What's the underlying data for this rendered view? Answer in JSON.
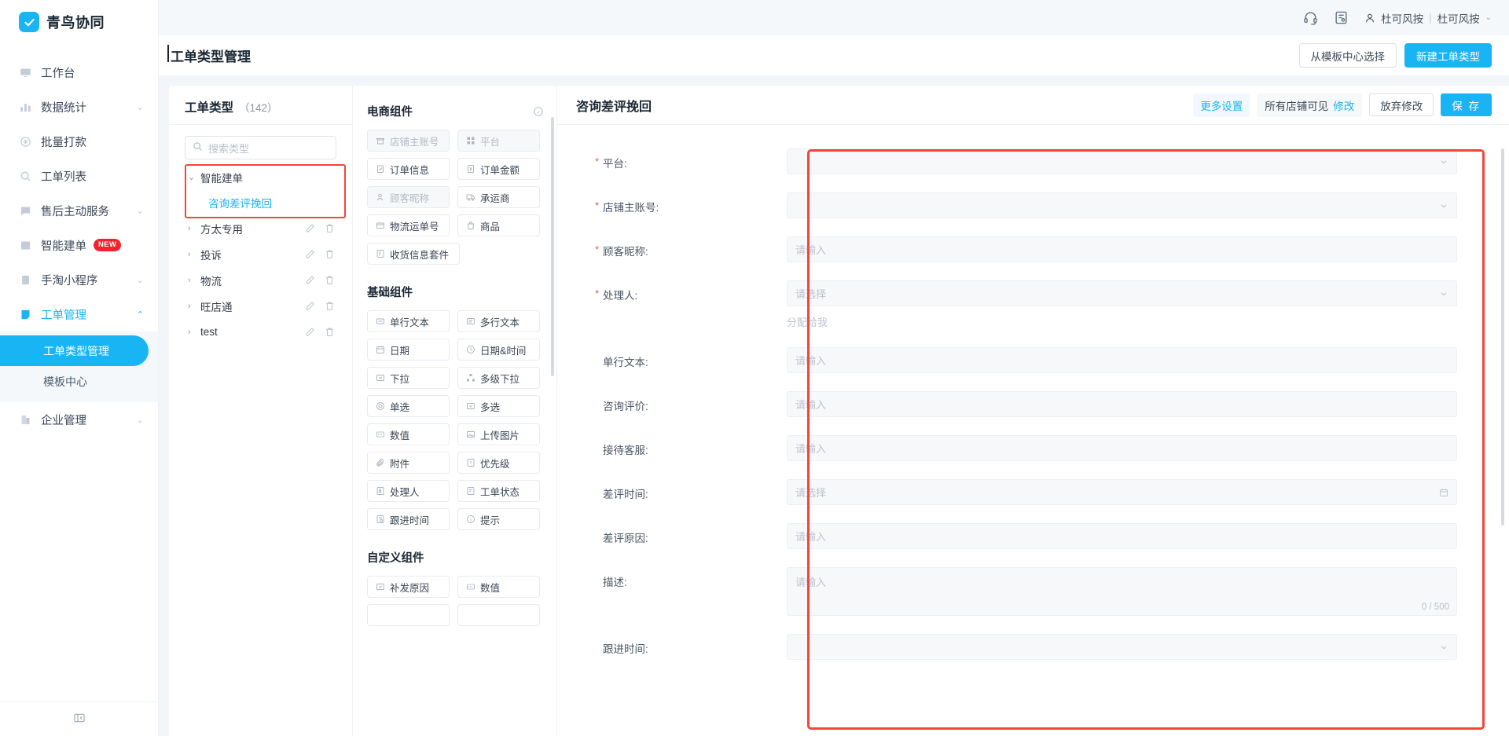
{
  "brand": {
    "name": "青鸟协同",
    "mark_icon": "check-badge-icon"
  },
  "sidebar": {
    "items": [
      {
        "label": "工作台",
        "icon": "desktop-icon",
        "caret": "",
        "active": false
      },
      {
        "label": "数据统计",
        "icon": "bar-chart-icon",
        "caret": "⌄",
        "active": false
      },
      {
        "label": "批量打款",
        "icon": "coin-icon",
        "caret": "",
        "active": false
      },
      {
        "label": "工单列表",
        "icon": "search-icon",
        "caret": "",
        "active": false
      },
      {
        "label": "售后主动服务",
        "icon": "message-check-icon",
        "caret": "⌄",
        "active": false
      },
      {
        "label": "智能建单",
        "icon": "list-icon",
        "caret": "",
        "badge": "NEW",
        "active": false
      },
      {
        "label": "手淘小程序",
        "icon": "clipboard-icon",
        "caret": "⌄",
        "active": false
      },
      {
        "label": "工单管理",
        "icon": "ticket-icon",
        "caret": "⌃",
        "active": true
      },
      {
        "label": "企业管理",
        "icon": "building-icon",
        "caret": "⌄",
        "active": false
      }
    ],
    "sub_items": [
      {
        "label": "工单类型管理",
        "selected": true
      },
      {
        "label": "模板中心",
        "selected": false
      }
    ],
    "collapse_icon": "collapse-sidebar-icon"
  },
  "topbar": {
    "headset_icon": "headset-icon",
    "doc_icon": "document-icon",
    "user_icon": "user-icon",
    "user_name": "杜可风按",
    "separator": "|",
    "account_name": "杜可风按",
    "caret": "⌄"
  },
  "page": {
    "title": "工单类型管理",
    "actions": [
      {
        "label": "从模板中心选择",
        "primary": false
      },
      {
        "label": "新建工单类型",
        "primary": true
      }
    ]
  },
  "types_panel": {
    "title": "工单类型",
    "count": "（142）",
    "search_placeholder": "搜索类型",
    "search_icon": "search-icon",
    "tree": [
      {
        "label": "智能建单",
        "arrow": "⌄",
        "expanded": true,
        "highlighted": true,
        "has_actions": false,
        "children": [
          {
            "label": "咨询差评挽回",
            "selected": true
          }
        ]
      },
      {
        "label": "方太专用",
        "arrow": "›",
        "expanded": false,
        "has_actions": true,
        "children": []
      },
      {
        "label": "投诉",
        "arrow": "›",
        "expanded": false,
        "has_actions": true,
        "children": []
      },
      {
        "label": "物流",
        "arrow": "›",
        "expanded": false,
        "has_actions": true,
        "children": []
      },
      {
        "label": "旺店通",
        "arrow": "›",
        "expanded": false,
        "has_actions": true,
        "children": []
      },
      {
        "label": "test",
        "arrow": "›",
        "expanded": false,
        "has_actions": true,
        "children": []
      }
    ],
    "edit_icon": "pencil-icon",
    "delete_icon": "trash-icon"
  },
  "palette": {
    "info_icon": "info-circle-icon",
    "sections": [
      {
        "title": "电商组件",
        "items": [
          {
            "label": "店铺主账号",
            "icon": "shop-icon",
            "disabled": true
          },
          {
            "label": "平台",
            "icon": "grid-icon",
            "disabled": true
          },
          {
            "label": "订单信息",
            "icon": "clipboard-check-icon",
            "disabled": false
          },
          {
            "label": "订单金额",
            "icon": "money-icon",
            "disabled": false
          },
          {
            "label": "顾客昵称",
            "icon": "user-icon",
            "disabled": true
          },
          {
            "label": "承运商",
            "icon": "truck-icon",
            "disabled": false
          },
          {
            "label": "物流运单号",
            "icon": "package-icon",
            "disabled": false
          },
          {
            "label": "商品",
            "icon": "bag-icon",
            "disabled": false
          },
          {
            "label": "收货信息套件",
            "icon": "address-icon",
            "disabled": false
          }
        ]
      },
      {
        "title": "基础组件",
        "items": [
          {
            "label": "单行文本",
            "icon": "single-line-icon",
            "disabled": false
          },
          {
            "label": "多行文本",
            "icon": "multi-line-icon",
            "disabled": false
          },
          {
            "label": "日期",
            "icon": "calendar-icon",
            "disabled": false
          },
          {
            "label": "日期&时间",
            "icon": "clock-icon",
            "disabled": false
          },
          {
            "label": "下拉",
            "icon": "dropdown-icon",
            "disabled": false
          },
          {
            "label": "多级下拉",
            "icon": "cascader-icon",
            "disabled": false
          },
          {
            "label": "单选",
            "icon": "radio-icon",
            "disabled": false
          },
          {
            "label": "多选",
            "icon": "checkbox-icon",
            "disabled": false
          },
          {
            "label": "数值",
            "icon": "number-icon",
            "disabled": false
          },
          {
            "label": "上传图片",
            "icon": "image-icon",
            "disabled": false
          },
          {
            "label": "附件",
            "icon": "paperclip-icon",
            "disabled": false
          },
          {
            "label": "优先级",
            "icon": "priority-icon",
            "disabled": false
          },
          {
            "label": "处理人",
            "icon": "assignee-icon",
            "disabled": false
          },
          {
            "label": "工单状态",
            "icon": "status-icon",
            "disabled": false
          },
          {
            "label": "跟进时间",
            "icon": "followup-icon",
            "disabled": false
          },
          {
            "label": "提示",
            "icon": "info-circle-icon",
            "disabled": false
          }
        ]
      },
      {
        "title": "自定义组件",
        "items": [
          {
            "label": "补发原因",
            "icon": "dropdown-icon",
            "disabled": false
          },
          {
            "label": "数值",
            "icon": "number-icon",
            "disabled": false
          }
        ]
      }
    ]
  },
  "form": {
    "name": "咨询差评挽回",
    "more_settings": "更多设置",
    "visibility": "所有店铺可见",
    "visibility_edit": "修改",
    "discard": "放弃修改",
    "save": "保 存",
    "fields": [
      {
        "label": "平台:",
        "required": true,
        "type": "select",
        "placeholder": "",
        "suffix": "chevron-down-icon"
      },
      {
        "label": "店铺主账号:",
        "required": true,
        "type": "select",
        "placeholder": "",
        "suffix": "chevron-down-icon"
      },
      {
        "label": "顾客昵称:",
        "required": true,
        "type": "input",
        "placeholder": "请输入",
        "suffix": ""
      },
      {
        "label": "处理人:",
        "required": true,
        "type": "select",
        "placeholder": "请选择",
        "suffix": "chevron-down-icon",
        "note": "分配给我"
      },
      {
        "label": "单行文本:",
        "required": false,
        "type": "input",
        "placeholder": "请输入",
        "suffix": ""
      },
      {
        "label": "咨询评价:",
        "required": false,
        "type": "input",
        "placeholder": "请输入",
        "suffix": ""
      },
      {
        "label": "接待客服:",
        "required": false,
        "type": "input",
        "placeholder": "请输入",
        "suffix": ""
      },
      {
        "label": "差评时间:",
        "required": false,
        "type": "date",
        "placeholder": "请选择",
        "suffix": "calendar-icon"
      },
      {
        "label": "差评原因:",
        "required": false,
        "type": "input",
        "placeholder": "请输入",
        "suffix": ""
      },
      {
        "label": "描述:",
        "required": false,
        "type": "textarea",
        "placeholder": "请输入",
        "counter": "0 / 500"
      },
      {
        "label": "跟进时间:",
        "required": false,
        "type": "select",
        "placeholder": "",
        "suffix": "chevron-down-icon"
      }
    ]
  },
  "colors": {
    "brand": "#19b4f4",
    "highlight": "#f5453a",
    "required": "#f0565a",
    "badge": "#f5222d"
  }
}
